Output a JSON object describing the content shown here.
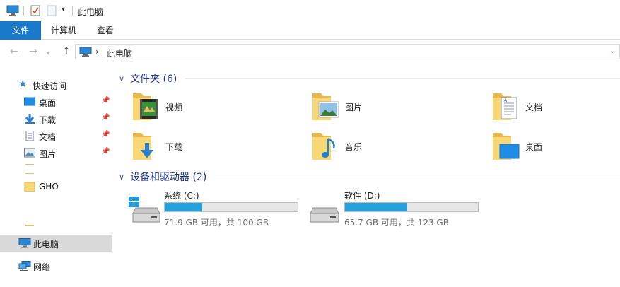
{
  "window": {
    "title": "此电脑"
  },
  "ribbon": {
    "tabs": [
      "文件",
      "计算机",
      "查看"
    ]
  },
  "address": {
    "path": "此电脑"
  },
  "navpane": {
    "quick_access": "快速访问",
    "pinned": [
      {
        "label": "桌面",
        "icon": "desktop-icon"
      },
      {
        "label": "下载",
        "icon": "download-icon"
      },
      {
        "label": "文档",
        "icon": "document-icon"
      },
      {
        "label": "图片",
        "icon": "picture-icon"
      }
    ],
    "gho": "GHO",
    "this_pc": "此电脑",
    "network": "网络"
  },
  "folders": {
    "header": "文件夹 (6)",
    "items": [
      {
        "label": "视频",
        "icon": "video-folder-icon"
      },
      {
        "label": "图片",
        "icon": "pictures-folder-icon"
      },
      {
        "label": "文档",
        "icon": "documents-folder-icon"
      },
      {
        "label": "下载",
        "icon": "downloads-folder-icon"
      },
      {
        "label": "音乐",
        "icon": "music-folder-icon"
      },
      {
        "label": "桌面",
        "icon": "desktop-folder-icon"
      }
    ]
  },
  "drives": {
    "header": "设备和驱动器 (2)",
    "items": [
      {
        "name": "系统 (C:)",
        "free": "71.9 GB 可用，共 100 GB",
        "used_fraction": 0.281
      },
      {
        "name": "软件 (D:)",
        "free": "65.7 GB 可用，共 123 GB",
        "used_fraction": 0.466
      }
    ]
  },
  "colors": {
    "accent": "#1979ca",
    "bar_fill": "#26a0da",
    "group_title": "#1e3287",
    "folder": "#f8d775"
  }
}
